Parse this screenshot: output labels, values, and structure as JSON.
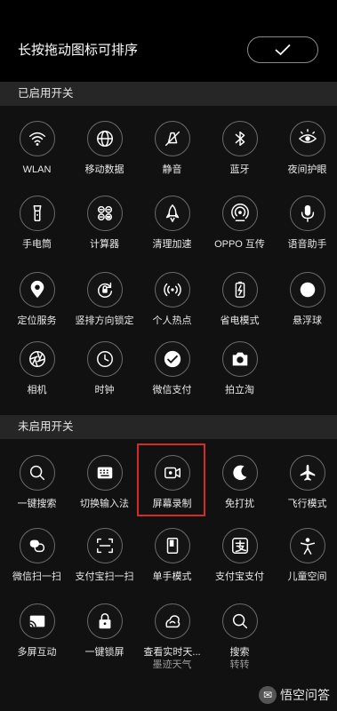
{
  "header": {
    "title": "长按拖动图标可排序",
    "done_icon": "check-icon"
  },
  "sections": {
    "enabled_title": "已启用开关",
    "disabled_title": "未启用开关"
  },
  "enabled": [
    {
      "label": "WLAN",
      "icon": "wifi-icon"
    },
    {
      "label": "移动数据",
      "icon": "globe-icon"
    },
    {
      "label": "静音",
      "icon": "mute-icon"
    },
    {
      "label": "蓝牙",
      "icon": "bluetooth-icon"
    },
    {
      "label": "夜间护眼",
      "icon": "eye-icon"
    },
    {
      "label": "手电筒",
      "icon": "flashlight-icon"
    },
    {
      "label": "计算器",
      "icon": "calculator-icon"
    },
    {
      "label": "清理加速",
      "icon": "rocket-icon"
    },
    {
      "label": "OPPO 互传",
      "icon": "share-icon"
    },
    {
      "label": "语音助手",
      "icon": "microphone-icon"
    },
    {
      "label": "定位服务",
      "icon": "location-icon"
    },
    {
      "label": "竖排方向锁定",
      "icon": "rotation-lock-icon"
    },
    {
      "label": "个人热点",
      "icon": "hotspot-icon"
    },
    {
      "label": "省电模式",
      "icon": "battery-icon"
    },
    {
      "label": "悬浮球",
      "icon": "floating-ball-icon"
    },
    {
      "label": "相机",
      "icon": "camera-aperture-icon"
    },
    {
      "label": "时钟",
      "icon": "clock-icon"
    },
    {
      "label": "微信支付",
      "icon": "wechat-pay-icon"
    },
    {
      "label": "拍立淘",
      "icon": "camera-icon"
    }
  ],
  "disabled": [
    {
      "label": "一键搜索",
      "icon": "search-icon"
    },
    {
      "label": "切换输入法",
      "icon": "keyboard-icon"
    },
    {
      "label": "屏幕录制",
      "icon": "screen-record-icon"
    },
    {
      "label": "免打扰",
      "icon": "moon-icon"
    },
    {
      "label": "飞行模式",
      "icon": "airplane-icon"
    },
    {
      "label": "微信扫一扫",
      "icon": "wechat-scan-icon"
    },
    {
      "label": "支付宝扫一扫",
      "icon": "scan-icon"
    },
    {
      "label": "单手模式",
      "icon": "one-hand-icon"
    },
    {
      "label": "支付宝支付",
      "icon": "alipay-icon"
    },
    {
      "label": "儿童空间",
      "icon": "child-icon"
    },
    {
      "label": "多屏互动",
      "icon": "cast-icon"
    },
    {
      "label": "一键锁屏",
      "icon": "lock-icon"
    },
    {
      "label": "查看实时天...",
      "sublabel": "墨迹天气",
      "icon": "weather-icon"
    },
    {
      "label": "搜索",
      "sublabel": "转转",
      "icon": "search-icon"
    }
  ],
  "watermark": {
    "text": "悟空问答"
  },
  "colors": {
    "background": "#000000",
    "section_header": "#262626",
    "highlight": "#d22b2b"
  }
}
